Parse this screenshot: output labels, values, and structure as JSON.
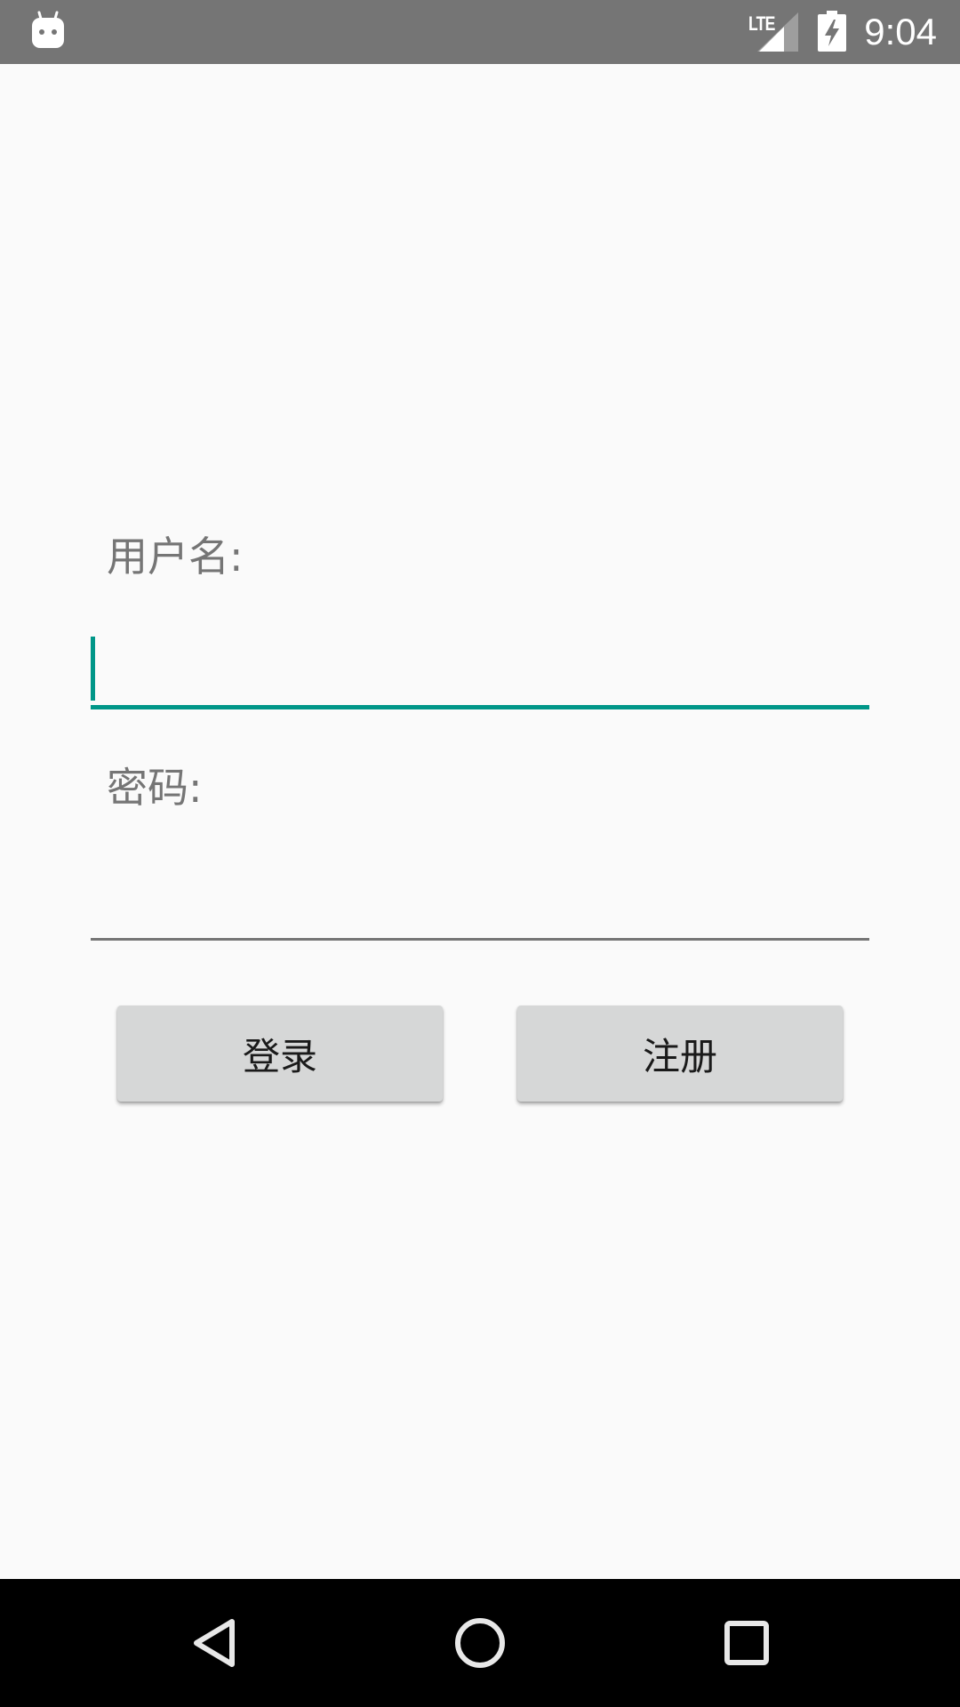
{
  "status_bar": {
    "network_label": "LTE",
    "time": "9:04",
    "icons": [
      "android-notification-icon",
      "signal-icon",
      "battery-charging-icon"
    ]
  },
  "form": {
    "username_label": "用户名:",
    "username_value": "",
    "password_label": "密码:",
    "password_value": ""
  },
  "buttons": {
    "login_label": "登录",
    "register_label": "注册"
  },
  "nav_bar": {
    "icons": [
      "back-icon",
      "home-icon",
      "recents-icon"
    ]
  },
  "colors": {
    "accent": "#009688",
    "status_bar": "#757575",
    "background": "#FAFAFA",
    "button": "#D6D7D7",
    "label_text": "#757575"
  }
}
